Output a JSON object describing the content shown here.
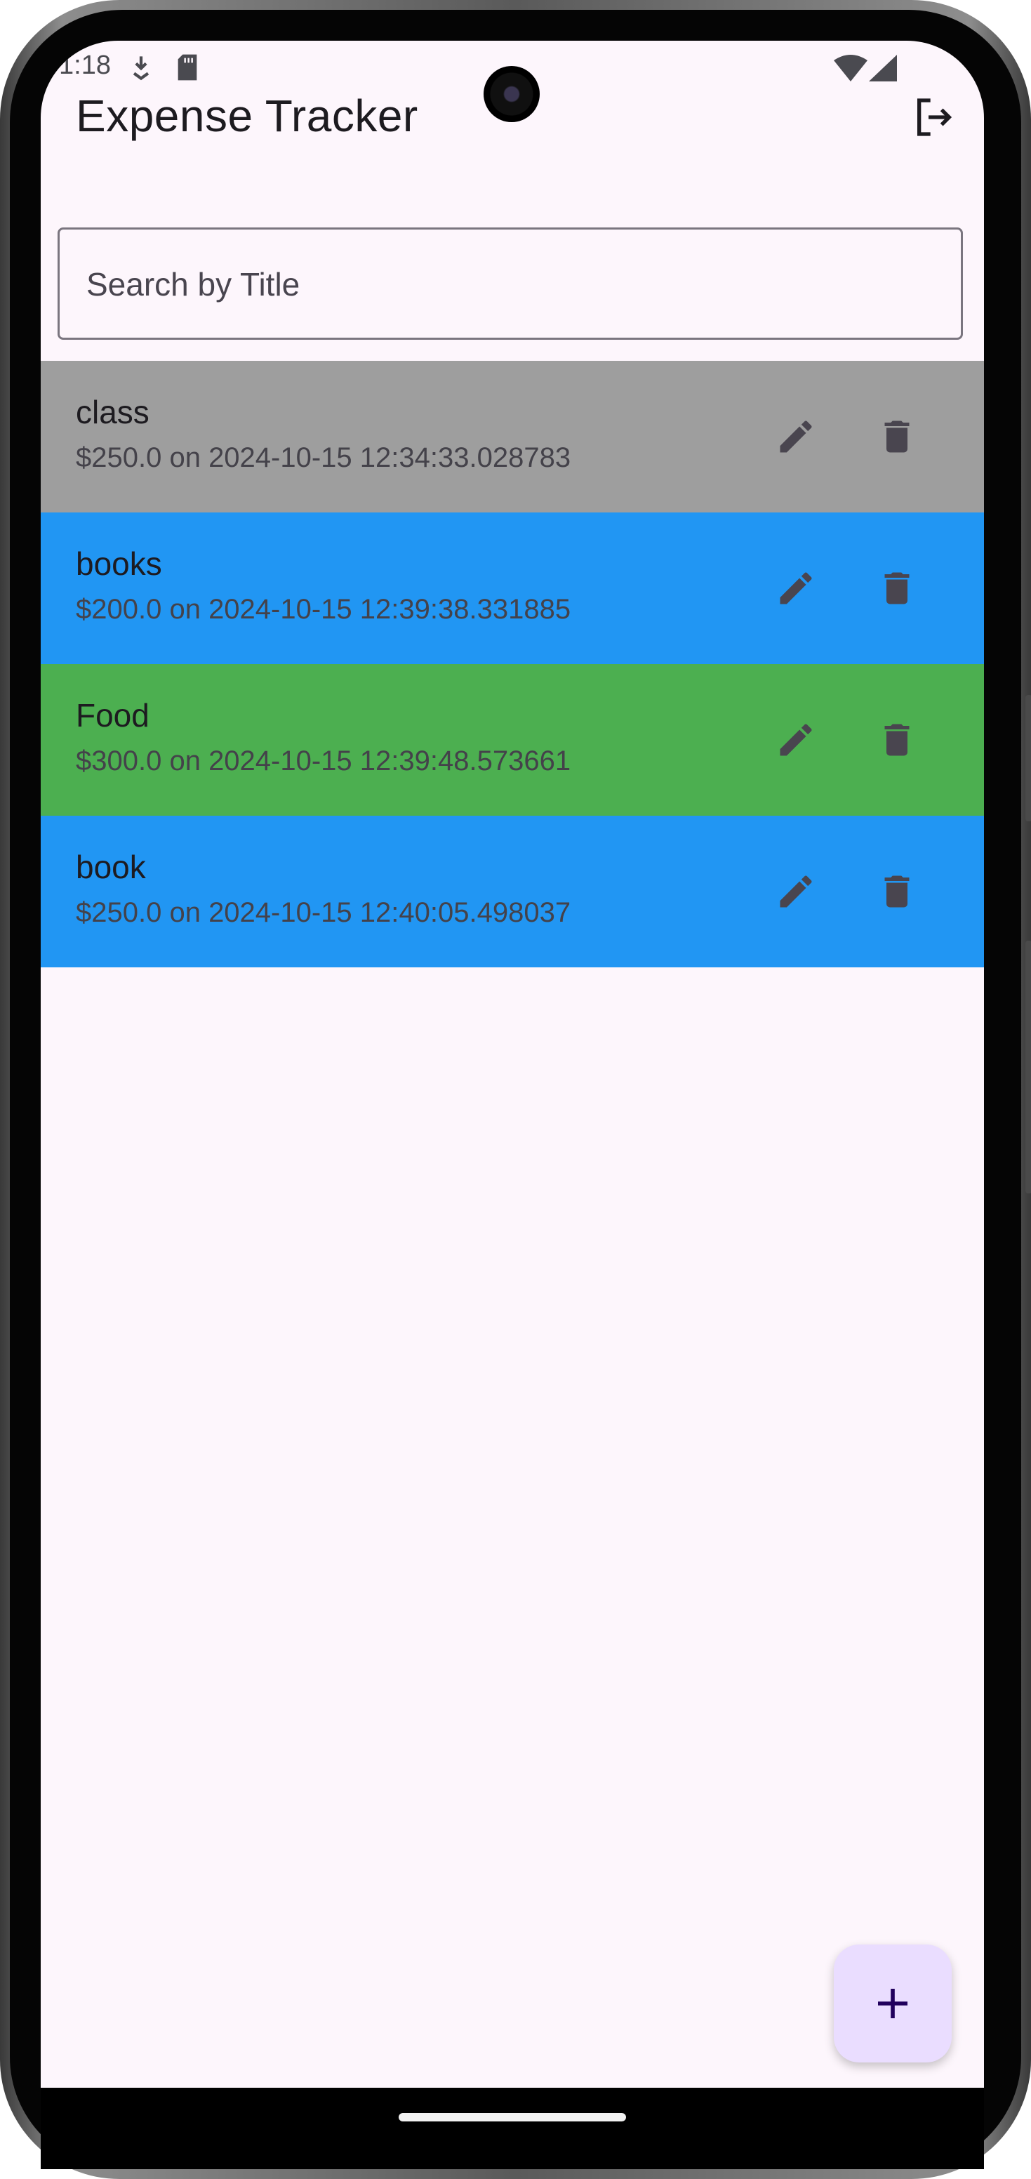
{
  "colors": {
    "screen_bg": "#fdf6fc",
    "row_class": "#9e9e9e",
    "row_books": "#2196f3",
    "row_food": "#4caf50",
    "row_book": "#2196f3",
    "icon": "#49454f",
    "fab_bg": "#eaddff",
    "fab_icon": "#21005d"
  },
  "status_bar": {
    "time": "1:18",
    "icons": [
      "download-icon",
      "sd-card-icon",
      "wifi-icon",
      "signal-icon"
    ]
  },
  "app_bar": {
    "title": "Expense Tracker",
    "action_icon": "logout-icon"
  },
  "search": {
    "placeholder": "Search by Title",
    "value": ""
  },
  "expenses": [
    {
      "title": "class",
      "subtitle": "$250.0 on 2024-10-15 12:34:33.028783",
      "color": "#9e9e9e"
    },
    {
      "title": "books",
      "subtitle": "$200.0 on 2024-10-15 12:39:38.331885",
      "color": "#2196f3"
    },
    {
      "title": "Food",
      "subtitle": "$300.0 on 2024-10-15 12:39:48.573661",
      "color": "#4caf50"
    },
    {
      "title": "book",
      "subtitle": "$250.0 on 2024-10-15 12:40:05.498037",
      "color": "#2196f3"
    }
  ],
  "row_actions": [
    "edit-icon",
    "delete-icon"
  ],
  "fab": {
    "icon": "add-icon"
  }
}
